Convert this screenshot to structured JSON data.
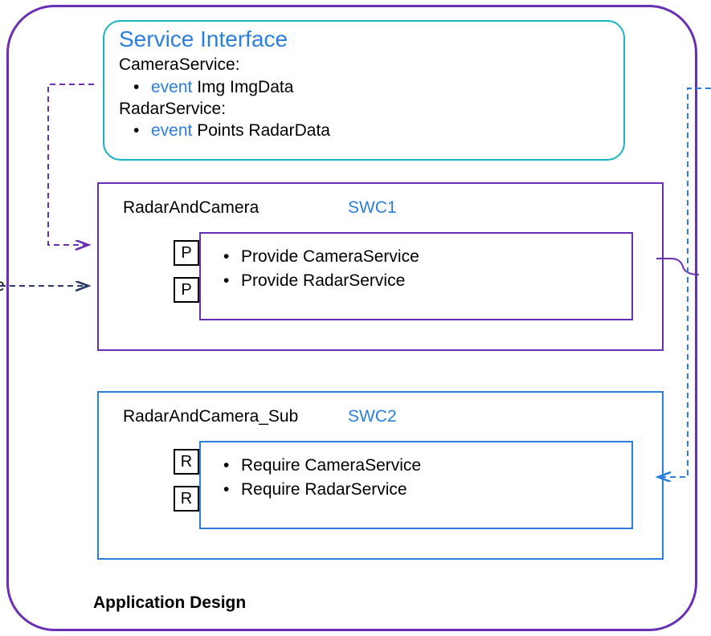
{
  "title_label": "Application Design",
  "service_interface": {
    "title": "Service Interface",
    "camera_label": "CameraService:",
    "camera_event_kw": "event",
    "camera_event_rest": " Img  ImgData",
    "radar_label": "RadarService:",
    "radar_event_kw": "event",
    "radar_event_rest": " Points RadarData"
  },
  "swc1": {
    "name": "RadarAndCamera",
    "tag": "SWC1",
    "port_top": "P",
    "port_bottom": "P",
    "line1_prefix": "Provide ",
    "line1_svc": "CameraService",
    "line2_prefix": "Provide ",
    "line2_svc": "RadarService"
  },
  "swc2": {
    "name": "RadarAndCamera_Sub",
    "tag": "SWC2",
    "port_top": "R",
    "port_bottom": "R",
    "line1_prefix": "Require ",
    "line1_svc": "CameraService",
    "line2_prefix": "Require ",
    "line2_svc": "RadarService"
  },
  "colors": {
    "purple": "#6a2fb5",
    "blue": "#2a7fde",
    "teal": "#19b4c4",
    "dash": "#3a3a6a"
  }
}
